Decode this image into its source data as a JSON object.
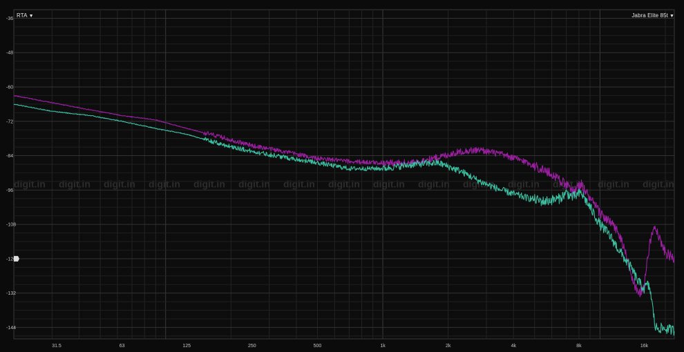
{
  "menus": {
    "left_label": "RTA",
    "right_label": "Jabra Elite 85t",
    "caret": "▼"
  },
  "watermark": "digit.in",
  "chart_data": {
    "type": "line",
    "title": "",
    "xlabel": "",
    "ylabel": "",
    "x_scale": "log",
    "xlim": [
      20,
      22000
    ],
    "ylim": [
      -148,
      -33
    ],
    "grid": true,
    "y_ticks": [
      -36,
      -48,
      -60,
      -72,
      -84,
      -96,
      -108,
      -120,
      -132,
      -144
    ],
    "x_ticks": [
      {
        "value": 31.5,
        "label": "31.5"
      },
      {
        "value": 63,
        "label": "63"
      },
      {
        "value": 125,
        "label": "125"
      },
      {
        "value": 250,
        "label": "250"
      },
      {
        "value": 500,
        "label": "500"
      },
      {
        "value": 1000,
        "label": "1k"
      },
      {
        "value": 2000,
        "label": "2k"
      },
      {
        "value": 4000,
        "label": "4k"
      },
      {
        "value": 8000,
        "label": "8k"
      },
      {
        "value": 16000,
        "label": "16k"
      }
    ],
    "reference_marker": {
      "y": -120,
      "color": "#dddddd"
    },
    "series": [
      {
        "color": "#9c1fa2",
        "x": [
          20,
          30,
          45,
          63,
          90,
          125,
          180,
          250,
          350,
          500,
          700,
          1000,
          1400,
          1800,
          2300,
          2800,
          3500,
          4500,
          5500,
          6500,
          7000,
          7500,
          8200,
          9000,
          10000,
          11000,
          12000,
          13000,
          14000,
          15000,
          16000,
          17000,
          18000,
          19000,
          20000,
          22000
        ],
        "y": [
          -63,
          -65.5,
          -68,
          -70,
          -71.5,
          -74.5,
          -77.5,
          -80.5,
          -82.5,
          -85,
          -86,
          -86.5,
          -86.5,
          -84.5,
          -82.5,
          -82,
          -83.5,
          -86,
          -89,
          -92,
          -94.5,
          -96.5,
          -94,
          -99,
          -104,
          -107,
          -110,
          -117,
          -126,
          -133,
          -129,
          -114,
          -108,
          -114,
          -118,
          -120
        ]
      },
      {
        "color": "#3cbea0",
        "x": [
          20,
          30,
          45,
          63,
          90,
          125,
          180,
          250,
          350,
          500,
          700,
          1000,
          1400,
          1800,
          2300,
          2800,
          3500,
          4500,
          5500,
          6500,
          7000,
          7500,
          8200,
          9000,
          10000,
          11000,
          12000,
          13000,
          14000,
          15000,
          16000,
          16500,
          17000,
          18000,
          20000,
          22000
        ],
        "y": [
          -66,
          -68.5,
          -70,
          -72,
          -74.5,
          -76.5,
          -80,
          -82.5,
          -84.5,
          -86.5,
          -88.5,
          -88.5,
          -87,
          -86.5,
          -89.5,
          -93,
          -96,
          -98.5,
          -100,
          -99,
          -97,
          -98.5,
          -97,
          -102,
          -108,
          -111.5,
          -116,
          -120,
          -123.5,
          -128,
          -130.5,
          -129,
          -130.5,
          -144,
          -144.5,
          -145
        ]
      }
    ]
  }
}
